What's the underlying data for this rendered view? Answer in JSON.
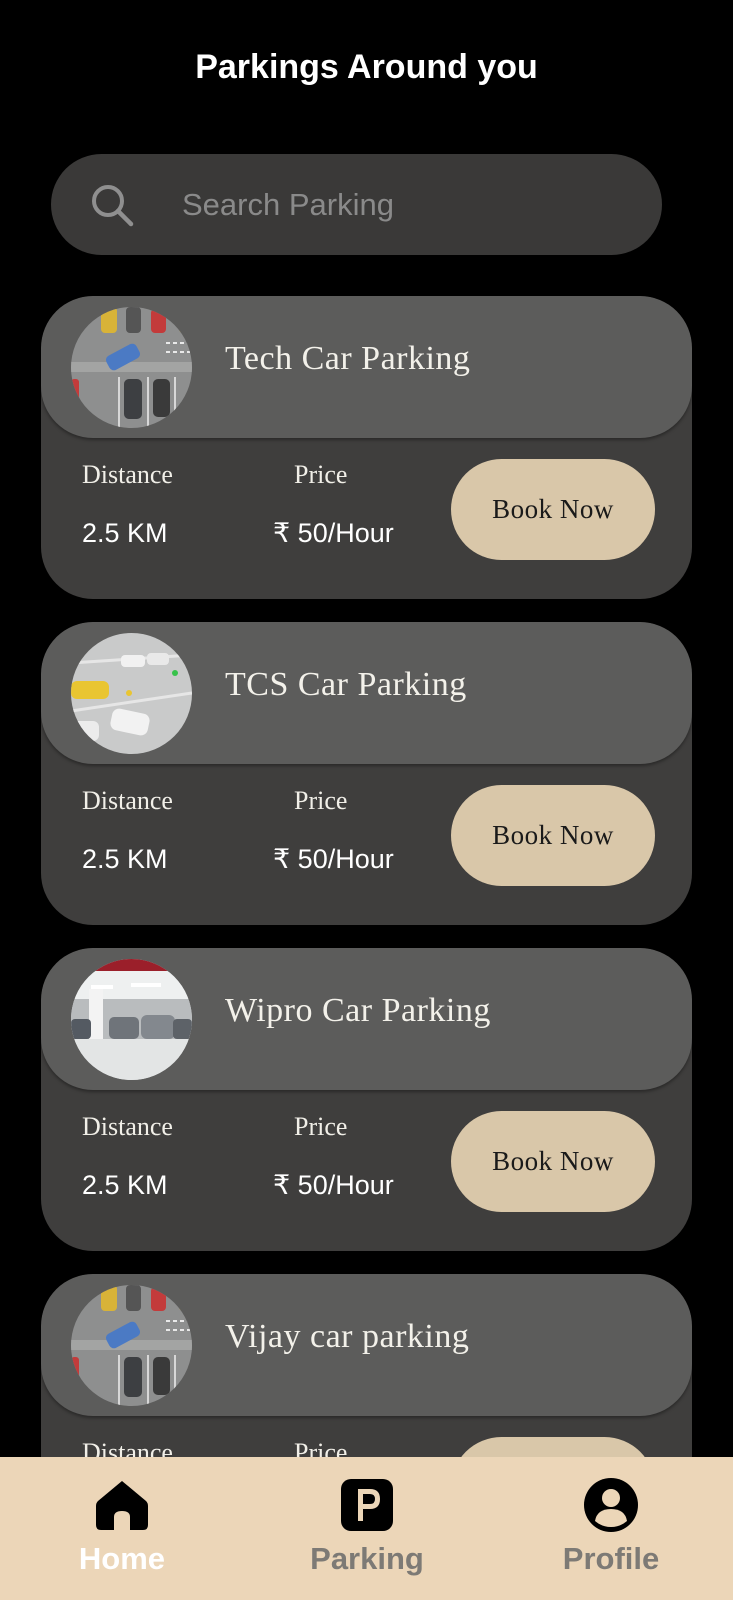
{
  "header": {
    "title": "Parkings Around you"
  },
  "search": {
    "placeholder": "Search Parking",
    "value": ""
  },
  "cards": [
    {
      "name": "Tech Car Parking",
      "distance_label": "Distance",
      "price_label": "Price",
      "distance": "2.5 KM",
      "price": "₹ 50/Hour",
      "button": "Book Now"
    },
    {
      "name": "TCS Car Parking",
      "distance_label": "Distance",
      "price_label": "Price",
      "distance": "2.5 KM",
      "price": "₹ 50/Hour",
      "button": "Book Now"
    },
    {
      "name": "Wipro Car Parking",
      "distance_label": "Distance",
      "price_label": "Price",
      "distance": "2.5 KM",
      "price": "₹ 50/Hour",
      "button": "Book Now"
    },
    {
      "name": "Vijay car parking",
      "distance_label": "Distance",
      "price_label": "Price",
      "distance": "",
      "price": "",
      "button": ""
    }
  ],
  "nav": {
    "items": [
      {
        "label": "Home",
        "icon": "home-icon",
        "active": true
      },
      {
        "label": "Parking",
        "icon": "parking-icon",
        "active": false
      },
      {
        "label": "Profile",
        "icon": "profile-icon",
        "active": false
      }
    ]
  },
  "colors": {
    "background": "#000000",
    "card": "#3f3e3d",
    "card_header": "#5c5c5b",
    "button": "#d9c7a9",
    "nav_bar": "#ecd6b8",
    "nav_active": "#ffffff",
    "nav_inactive": "#7d7a75"
  }
}
